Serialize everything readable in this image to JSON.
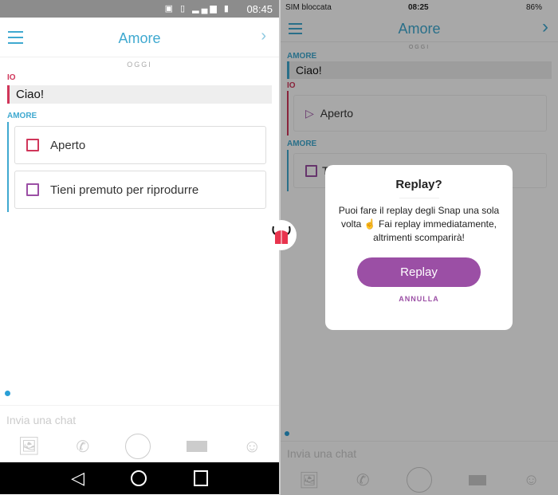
{
  "left": {
    "status": {
      "time": "08:45",
      "icons": [
        "nfc-icon",
        "vibrate-icon",
        "4g-icon",
        "signal-icon",
        "battery-icon"
      ]
    },
    "header": {
      "title": "Amore",
      "menu_icon": "hamburger-icon",
      "next_icon": "chevron-right-icon"
    },
    "day": "OGGI",
    "messages": [
      {
        "sender": "IO",
        "text": "Ciao!"
      },
      {
        "sender": "AMORE",
        "snaps": [
          "Aperto",
          "Tieni premuto per riprodurre"
        ]
      }
    ],
    "input_placeholder": "Invia una chat",
    "nav": [
      "back-icon",
      "home-icon",
      "recents-icon"
    ]
  },
  "right": {
    "status": {
      "carrier": "SIM bloccata",
      "time": "08:25",
      "battery": "86%"
    },
    "header": {
      "title": "Amore"
    },
    "day": "OGGI",
    "messages": [
      {
        "sender": "AMORE",
        "text": "Ciao!"
      },
      {
        "sender": "IO",
        "snap": "Aperto"
      },
      {
        "sender": "AMORE",
        "snap": "Ti"
      }
    ],
    "input_placeholder": "Invia una chat",
    "dialog": {
      "title": "Replay?",
      "body": "Puoi fare il replay degli Snap una sola volta ☝ Fai replay immediatamente, altrimenti scomparirà!",
      "confirm": "Replay",
      "cancel": "ANNULLA"
    }
  },
  "colors": {
    "accent": "#3fa9d0",
    "me": "#d0365a",
    "purple": "#9b4fa5"
  }
}
